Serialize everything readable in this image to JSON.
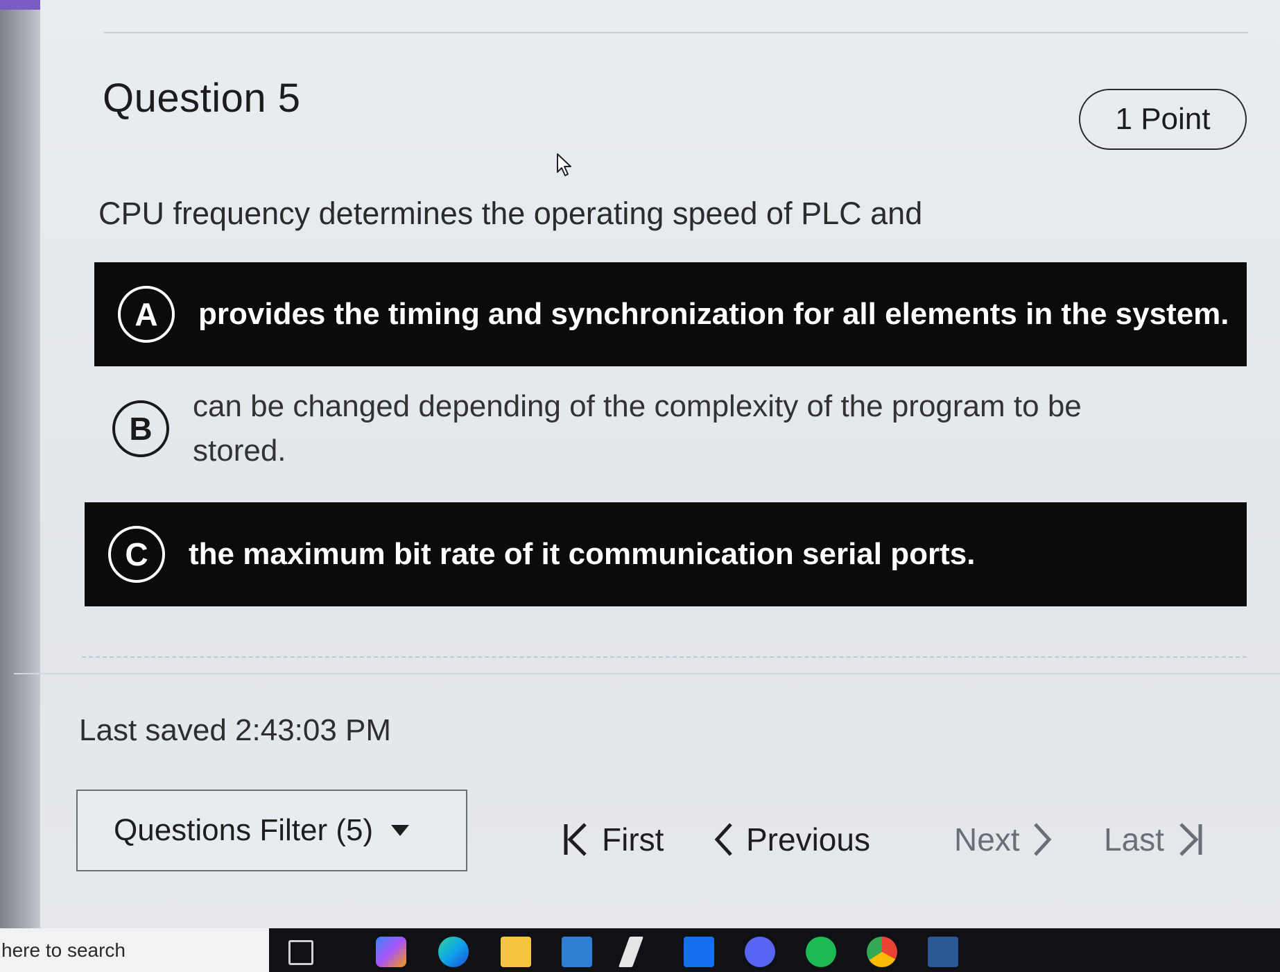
{
  "question": {
    "title": "Question 5",
    "points": "1 Point",
    "prompt": "CPU frequency determines the operating speed of PLC and"
  },
  "options": [
    {
      "letter": "A",
      "text": "provides the timing and synchronization for all elements in the system.",
      "selected": true
    },
    {
      "letter": "B",
      "text": "can be changed depending of the complexity of the program to be stored.",
      "selected": false
    },
    {
      "letter": "C",
      "text": "the maximum bit rate of it communication serial ports.",
      "selected": true
    }
  ],
  "status": {
    "last_saved": "Last saved 2:43:03 PM"
  },
  "footer": {
    "filter_label": "Questions Filter (5)",
    "first_label": "First",
    "previous_label": "Previous",
    "next_label": "Next",
    "last_label": "Last"
  },
  "taskbar": {
    "search_text": "here to search",
    "icons": [
      "task-view-icon",
      "copilot-icon",
      "edge-icon",
      "file-explorer-icon",
      "mail-icon",
      "power-automate-icon",
      "dropbox-icon",
      "discord-icon",
      "spotify-icon",
      "chrome-icon",
      "word-icon"
    ]
  },
  "colors": {
    "selected_option_bg": "#0b0b0c",
    "page_bg": "#e6e9ee",
    "disabled_nav": "#6a6e75"
  }
}
